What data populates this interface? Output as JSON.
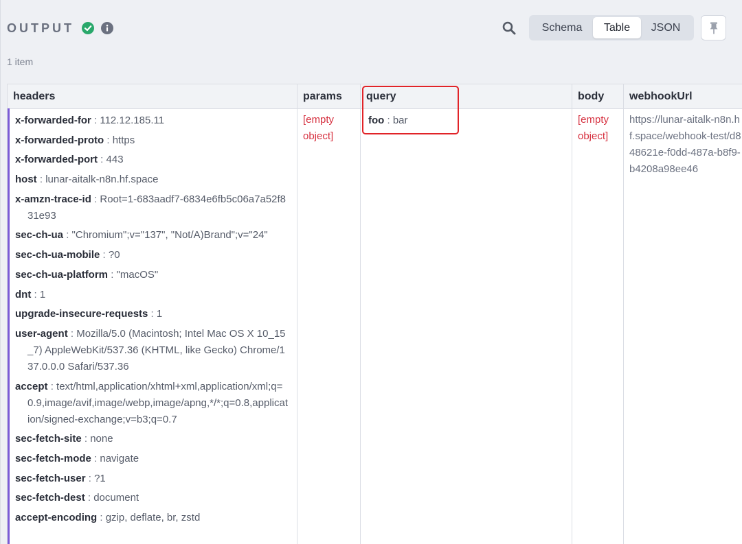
{
  "header": {
    "title": "OUTPUT",
    "view_tabs": [
      "Schema",
      "Table",
      "JSON"
    ],
    "active_tab": "Table"
  },
  "item_count": "1 item",
  "columns": [
    "headers",
    "params",
    "query",
    "body",
    "webhookUrl"
  ],
  "headers": [
    {
      "key": "x-forwarded-for",
      "value": "112.12.185.11"
    },
    {
      "key": "x-forwarded-proto",
      "value": "https"
    },
    {
      "key": "x-forwarded-port",
      "value": "443"
    },
    {
      "key": "host",
      "value": "lunar-aitalk-n8n.hf.space"
    },
    {
      "key": "x-amzn-trace-id",
      "value": "Root=1-683aadf7-6834e6fb5c06a7a52f831e93"
    },
    {
      "key": "sec-ch-ua",
      "value": "\"Chromium\";v=\"137\", \"Not/A)Brand\";v=\"24\""
    },
    {
      "key": "sec-ch-ua-mobile",
      "value": "?0"
    },
    {
      "key": "sec-ch-ua-platform",
      "value": "\"macOS\""
    },
    {
      "key": "dnt",
      "value": "1"
    },
    {
      "key": "upgrade-insecure-requests",
      "value": "1"
    },
    {
      "key": "user-agent",
      "value": "Mozilla/5.0 (Macintosh; Intel Mac OS X 10_15_7) AppleWebKit/537.36 (KHTML, like Gecko) Chrome/137.0.0.0 Safari/537.36"
    },
    {
      "key": "accept",
      "value": "text/html,application/xhtml+xml,application/xml;q=0.9,image/avif,image/webp,image/apng,*/*;q=0.8,application/signed-exchange;v=b3;q=0.7"
    },
    {
      "key": "sec-fetch-site",
      "value": "none"
    },
    {
      "key": "sec-fetch-mode",
      "value": "navigate"
    },
    {
      "key": "sec-fetch-user",
      "value": "?1"
    },
    {
      "key": "sec-fetch-dest",
      "value": "document"
    },
    {
      "key": "accept-encoding",
      "value": "gzip, deflate, br, zstd"
    }
  ],
  "params": "[empty object]",
  "query": [
    {
      "key": "foo",
      "value": "bar"
    }
  ],
  "body": "[empty object]",
  "webhookUrl": "https://lunar-aitalk-n8n.hf.space/webhook-test/d848621e-f0dd-487a-b8f9-b4208a98ee46",
  "colors": {
    "success": "#29a86b",
    "empty": "#d6303f",
    "row_accent": "#7b5bd6",
    "highlight": "#e12328"
  }
}
